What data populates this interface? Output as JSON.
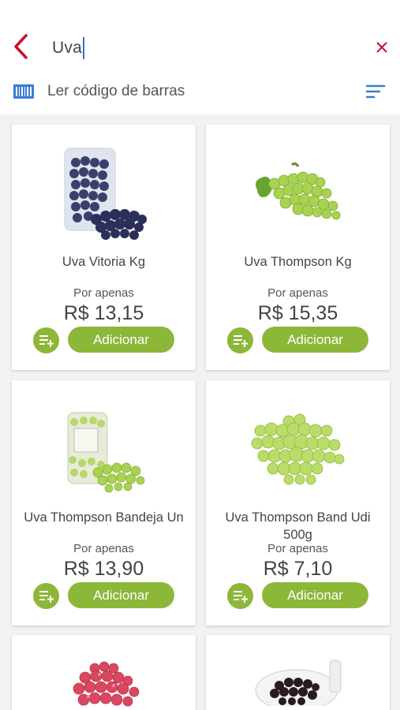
{
  "search": {
    "value": "Uva"
  },
  "toolbar": {
    "barcode_label": "Ler código de barras"
  },
  "icons": {
    "back": "back-arrow-icon",
    "clear": "close-icon",
    "barcode": "barcode-icon",
    "sort": "sort-icon"
  },
  "colors": {
    "accent_green": "#8cb739",
    "back_red": "#c8102e",
    "blue": "#3a7bd5"
  },
  "products": [
    {
      "name": "Uva Vitoria Kg",
      "by_label": "Por apenas",
      "price": "R$ 13,15",
      "add_label": "Adicionar"
    },
    {
      "name": "Uva Thompson Kg",
      "by_label": "Por apenas",
      "price": "R$ 15,35",
      "add_label": "Adicionar"
    },
    {
      "name": "Uva Thompson Bandeja Un",
      "by_label": "Por apenas",
      "price": "R$ 13,90",
      "add_label": "Adicionar"
    },
    {
      "name": "Uva Thompson Band Udi 500g",
      "by_label": "Por apenas",
      "price": "R$ 7,10",
      "add_label": "Adicionar"
    }
  ]
}
